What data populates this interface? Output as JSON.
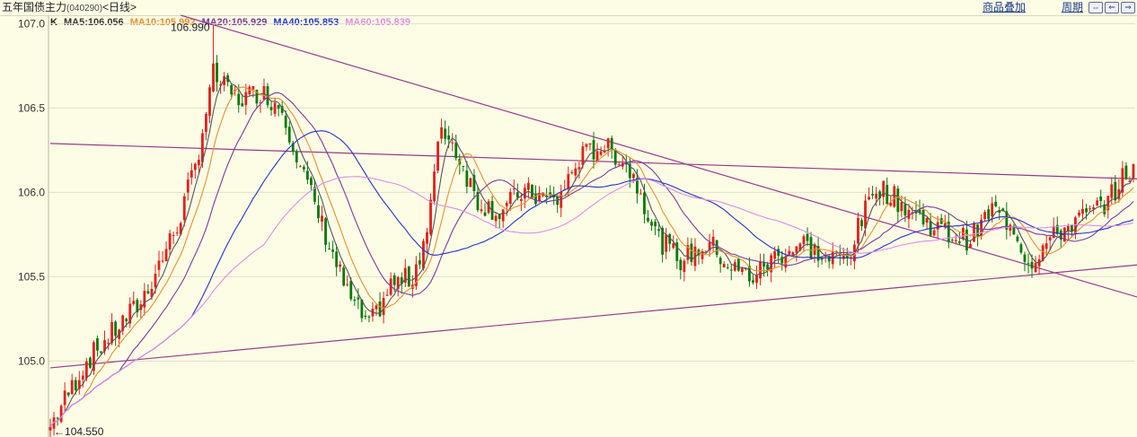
{
  "header": {
    "instrument": "五年国债主力",
    "code": "(040290)",
    "period": "<日线>",
    "overlay_link": "商品叠加",
    "period_link": "周期",
    "window_icons": [
      "restore-icon",
      "minimize-icon",
      "close-icon"
    ]
  },
  "legend": {
    "k_label": "K",
    "ma5": "MA5:106.056",
    "ma10": "MA10:105.992",
    "ma20": "MA20:105.929",
    "ma40": "MA40:105.853",
    "ma60": "MA60:105.839"
  },
  "colors": {
    "background": "#fdfde6",
    "up": "#e2211c",
    "down": "#0a7a0a",
    "ma5": "#555555",
    "ma10": "#e8902a",
    "ma20": "#7a3a9a",
    "ma40": "#2233cc",
    "ma60": "#e08ce8",
    "trendline": "#9a3a8a"
  },
  "chart_data": {
    "type": "candlestick",
    "ylim": [
      104.55,
      107.05
    ],
    "yticks": [
      "107.0",
      "106.5",
      "106.0",
      "105.5",
      "105.0"
    ],
    "yticks_values": [
      107.0,
      106.5,
      106.0,
      105.5,
      105.0
    ],
    "max_label": "106.990",
    "min_label": "104.550",
    "max_value": 106.99,
    "min_value": 104.55,
    "max_index": 45,
    "min_index": 0,
    "num_bars": 300,
    "price_path": [
      [
        0,
        104.62
      ],
      [
        10,
        105.0
      ],
      [
        25,
        105.35
      ],
      [
        35,
        105.8
      ],
      [
        40,
        106.15
      ],
      [
        45,
        106.7
      ],
      [
        48,
        106.62
      ],
      [
        52,
        106.55
      ],
      [
        58,
        106.6
      ],
      [
        64,
        106.5
      ],
      [
        70,
        106.1
      ],
      [
        76,
        105.75
      ],
      [
        82,
        105.4
      ],
      [
        88,
        105.2
      ],
      [
        94,
        105.45
      ],
      [
        100,
        105.5
      ],
      [
        104,
        105.78
      ],
      [
        108,
        106.4
      ],
      [
        112,
        106.25
      ],
      [
        118,
        105.95
      ],
      [
        124,
        105.88
      ],
      [
        130,
        106.0
      ],
      [
        140,
        105.95
      ],
      [
        146,
        106.2
      ],
      [
        152,
        106.28
      ],
      [
        158,
        106.2
      ],
      [
        162,
        106.05
      ],
      [
        168,
        105.72
      ],
      [
        174,
        105.6
      ],
      [
        182,
        105.7
      ],
      [
        188,
        105.55
      ],
      [
        194,
        105.5
      ],
      [
        200,
        105.62
      ],
      [
        208,
        105.7
      ],
      [
        214,
        105.6
      ],
      [
        220,
        105.62
      ],
      [
        228,
        106.05
      ],
      [
        234,
        105.95
      ],
      [
        240,
        105.85
      ],
      [
        248,
        105.75
      ],
      [
        254,
        105.72
      ],
      [
        260,
        105.9
      ],
      [
        266,
        105.8
      ],
      [
        270,
        105.58
      ],
      [
        276,
        105.72
      ],
      [
        282,
        105.82
      ],
      [
        288,
        105.88
      ],
      [
        293,
        105.98
      ],
      [
        297,
        106.12
      ]
    ],
    "ma_series": [
      {
        "name": "MA5",
        "window": 5
      },
      {
        "name": "MA10",
        "window": 10
      },
      {
        "name": "MA20",
        "window": 20
      },
      {
        "name": "MA40",
        "window": 40
      },
      {
        "name": "MA60",
        "window": 60
      }
    ],
    "trendlines": [
      {
        "from": [
          36,
          107.05
        ],
        "to": [
          300,
          105.38
        ]
      },
      {
        "from": [
          0,
          104.96
        ],
        "to": [
          300,
          105.57
        ]
      },
      {
        "from": [
          0,
          106.29
        ],
        "to": [
          300,
          106.08
        ]
      }
    ]
  }
}
